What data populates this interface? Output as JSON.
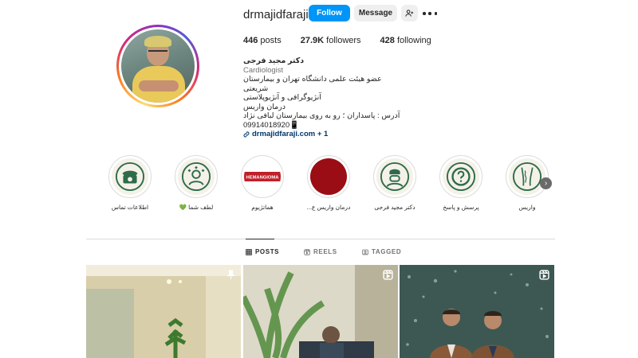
{
  "profile": {
    "username": "drmajidfaraji",
    "follow_label": "Follow",
    "message_label": "Message",
    "stats": {
      "posts_count": "446",
      "posts_label": "posts",
      "followers_count": "27.9K",
      "followers_label": "followers",
      "following_count": "428",
      "following_label": "following"
    },
    "bio": {
      "name": "دکتر مجید فرجی",
      "category": "Cardiologist",
      "line1": "عضو هیئت علمی دانشگاه تهران و بیمارستان شریعتی",
      "line2": "آنژیوگرافی و آنژیوپلاستی",
      "line3": "درمان واریس",
      "line4": "آدرس : پاسداران ؛ رو به روی بیمارستان لبافی نژاد",
      "phone": "09914018920📱",
      "link": "drmajidfaraji.com + 1"
    }
  },
  "highlights": [
    {
      "label": "اطلاعات تماس",
      "icon": "phone-icon"
    },
    {
      "label": "لطف شما 💚",
      "icon": "doctor-hearts-icon"
    },
    {
      "label": "هماتژیوم",
      "icon": "hemangioma-text",
      "badge": "HEMANGIOMA"
    },
    {
      "label": "درمان واریس ع...",
      "icon": "red-circle"
    },
    {
      "label": "دکتر مجید فرجی",
      "icon": "doctor-mask-icon"
    },
    {
      "label": "پرسش و پاسخ",
      "icon": "question-icon"
    },
    {
      "label": "واریس",
      "icon": "leg-veins-icon"
    }
  ],
  "tabs": [
    {
      "label": "POSTS",
      "icon": "grid-icon",
      "active": true
    },
    {
      "label": "REELS",
      "icon": "reels-icon",
      "active": false
    },
    {
      "label": "TAGGED",
      "icon": "tag-icon",
      "active": false
    }
  ],
  "colors": {
    "accent": "#0095f6",
    "highlight_green": "#2e6b4a",
    "hemangioma_red": "#c0202a",
    "red_circle": "#9a0d14"
  }
}
